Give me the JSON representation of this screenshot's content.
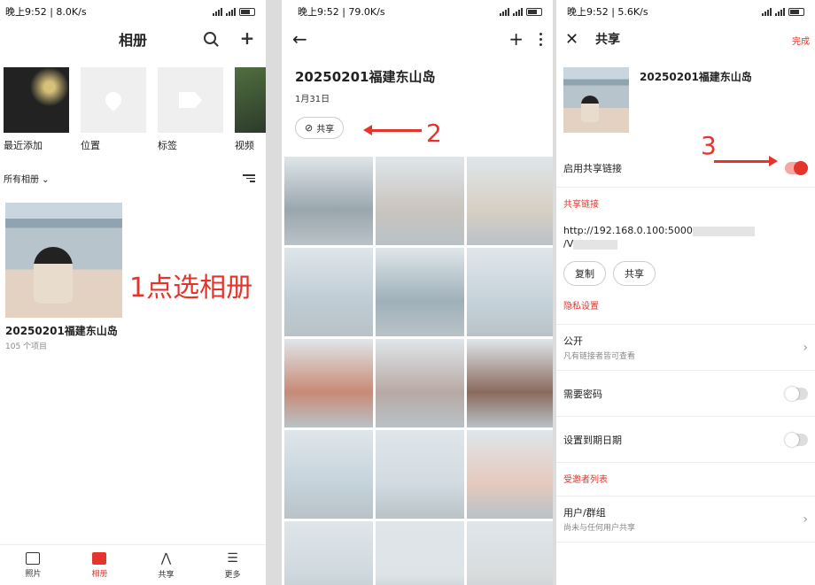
{
  "status": {
    "p1": {
      "time": "晚上9:52",
      "speed": "8.0K/s"
    },
    "p2": {
      "time": "晚上9:52",
      "speed": "79.0K/s"
    },
    "p3": {
      "time": "晚上9:52",
      "speed": "5.6K/s"
    }
  },
  "p1": {
    "title": "相册",
    "albums": [
      {
        "label": "最近添加"
      },
      {
        "label": "位置"
      },
      {
        "label": "标签"
      },
      {
        "label": "视频"
      }
    ],
    "filter_label": "所有相册",
    "album": {
      "name": "20250201福建东山岛",
      "count": "105 个项目"
    },
    "annotation": "1点选相册",
    "nav": [
      {
        "label": "照片"
      },
      {
        "label": "相册"
      },
      {
        "label": "共享"
      },
      {
        "label": "更多"
      }
    ]
  },
  "p2": {
    "title": "20250201福建东山岛",
    "date": "1月31日",
    "share_label": "共享",
    "annotation": "2",
    "photos": [
      {
        "color": "#9aa6ae"
      },
      {
        "color": "#c9c4be"
      },
      {
        "color": "#d8cfc4"
      },
      {
        "color": "#bfccd4"
      },
      {
        "color": "#9fb0b9"
      },
      {
        "color": "#c6d2da"
      },
      {
        "color": "#c88a76"
      },
      {
        "color": "#b8a9a4"
      },
      {
        "color": "#8a6a5e"
      },
      {
        "color": "#c5d3dc"
      },
      {
        "color": "#d2dbe1"
      },
      {
        "color": "#e6c9be"
      },
      {
        "color": "#cfd8de"
      },
      {
        "color": "#dde3e6"
      },
      {
        "color": "#d9dcdd"
      }
    ]
  },
  "p3": {
    "title": "共享",
    "done": "完成",
    "album_name": "20250201福建东山岛",
    "enable_label": "启用共享链接",
    "annotation": "3",
    "section_link": "共享链接",
    "link_line1": "http://192.168.0.100:5000",
    "link_line2": "/V",
    "copy_label": "复制",
    "share_label": "共享",
    "section_privacy": "隐私设置",
    "public_label": "公开",
    "public_sub": "凡有链接者皆可查看",
    "password_label": "需要密码",
    "expiry_label": "设置到期日期",
    "section_invitees": "受邀者列表",
    "users_label": "用户/群组",
    "users_sub": "尚未与任何用户共享"
  },
  "colors": {
    "accent": "#e5342c"
  }
}
